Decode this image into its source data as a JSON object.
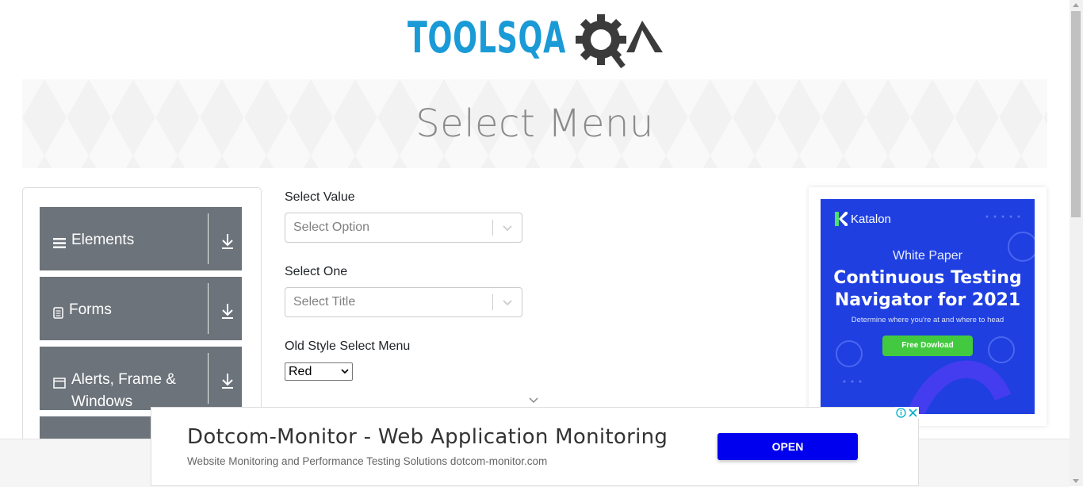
{
  "header": {
    "logo_text": "TOOLSQA"
  },
  "page_title": "Select Menu",
  "sidebar": {
    "groups": [
      {
        "label": "Elements",
        "icon": "hamburger-icon"
      },
      {
        "label": "Forms",
        "icon": "document-icon"
      },
      {
        "label": "Alerts, Frame & Windows",
        "icon": "window-icon"
      }
    ]
  },
  "form": {
    "select_value": {
      "label": "Select Value",
      "placeholder": "Select Option"
    },
    "select_one": {
      "label": "Select One",
      "placeholder": "Select Title"
    },
    "old_style": {
      "label": "Old Style Select Menu",
      "selected": "Red"
    }
  },
  "side_ad": {
    "brand": "Katalon",
    "kicker": "White Paper",
    "headline_line1": "Continuous Testing",
    "headline_line2": "Navigator for 2021",
    "subtext": "Determine where you're at and where to head",
    "button": "Free Dowload"
  },
  "bottom_ad": {
    "title": "Dotcom-Monitor - Web Application Monitoring",
    "description": "Website Monitoring and Performance Testing Solutions dotcom-monitor.com",
    "button": "OPEN"
  },
  "colors": {
    "accent_blue": "#1a9ad6",
    "sidebar_bg": "#6c737a",
    "ad_bg": "#1f3fe0",
    "open_btn": "#0000ee"
  }
}
